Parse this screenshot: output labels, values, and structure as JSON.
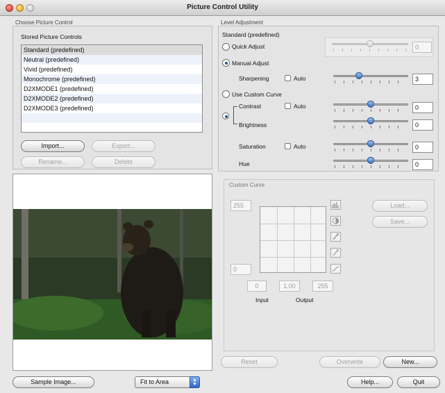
{
  "window": {
    "title": "Picture Control Utility"
  },
  "choose": {
    "section_label": "Choose Picture Control",
    "stored_label": "Stored Picture Controls",
    "items": [
      "Standard (predefined)",
      "Neutral (predefined)",
      "Vivid (predefined)",
      "Monochrome (predefined)",
      "D2XMODE1 (predefined)",
      "D2XMODE2 (predefined)",
      "D2XMODE3 (predefined)"
    ],
    "selected_index": 0,
    "buttons": {
      "import": "Import...",
      "export": "Export...",
      "rename": "Rename...",
      "delete": "Delete"
    }
  },
  "level": {
    "section_label": "Level Adjustment",
    "current": "Standard (predefined)",
    "quick_adjust": "Quick Adjust",
    "quick_value": "0",
    "manual_adjust": "Manual Adjust",
    "sharpening": {
      "label": "Sharpening",
      "auto": "Auto",
      "value": "3",
      "level": 0.33
    },
    "use_custom_curve": "Use Custom Curve",
    "contrast": {
      "label": "Contrast",
      "auto": "Auto",
      "value": "0",
      "level": 0.5
    },
    "brightness": {
      "label": "Brightness",
      "value": "0",
      "level": 0.5
    },
    "saturation": {
      "label": "Saturation",
      "auto": "Auto",
      "value": "0",
      "level": 0.5
    },
    "hue": {
      "label": "Hue",
      "value": "0",
      "level": 0.5
    }
  },
  "curve": {
    "section_label": "Custom Curve",
    "out_max": "255",
    "out_min": "0",
    "in_low": "0",
    "gamma": "1.00",
    "in_high": "255",
    "input_label": "Input",
    "output_label": "Output",
    "load": "Load...",
    "save": "Save..."
  },
  "actions": {
    "reset": "Reset",
    "overwrite": "Overwrite",
    "new": "New..."
  },
  "bottom": {
    "sample_image": "Sample Image...",
    "fit": "Fit to Area",
    "help": "Help...",
    "quit": "Quit"
  }
}
